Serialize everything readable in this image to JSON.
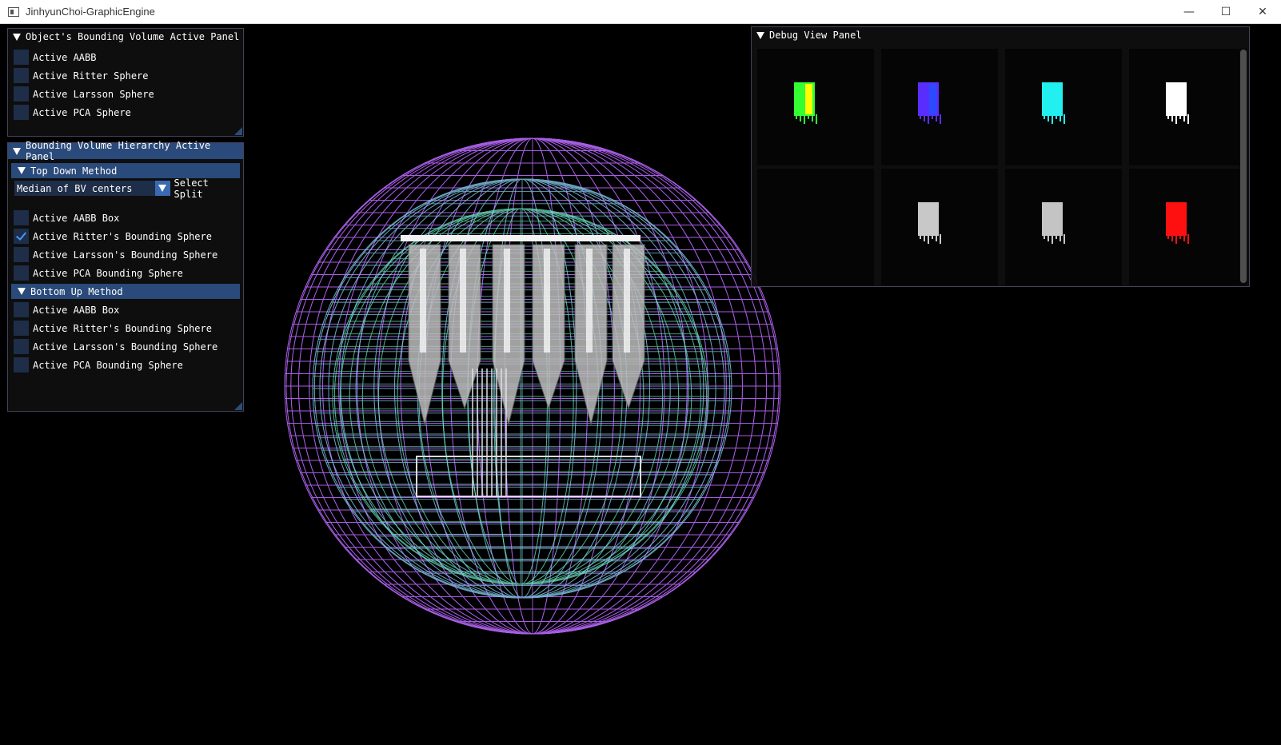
{
  "window": {
    "title": "JinhyunChoi-GraphicEngine",
    "minimize": "—",
    "maximize": "☐",
    "close": "✕"
  },
  "object_panel": {
    "title": "Object's Bounding Volume Active Panel",
    "items": [
      {
        "label": "Active AABB",
        "checked": false
      },
      {
        "label": "Active Ritter Sphere",
        "checked": false
      },
      {
        "label": "Active Larsson Sphere",
        "checked": false
      },
      {
        "label": "Active PCA Sphere",
        "checked": false
      }
    ]
  },
  "bvh_panel": {
    "title": "Bounding Volume Hierarchy Active Panel",
    "top_down": {
      "title": "Top Down Method",
      "split_value": "Median of BV centers",
      "split_label": "Select Split",
      "items": [
        {
          "label": "Active AABB Box",
          "checked": false
        },
        {
          "label": "Active Ritter's Bounding Sphere",
          "checked": true
        },
        {
          "label": "Active Larsson's Bounding Sphere",
          "checked": false
        },
        {
          "label": "Active PCA Bounding Sphere",
          "checked": false
        }
      ]
    },
    "bottom_up": {
      "title": "Bottom Up Method",
      "items": [
        {
          "label": "Active AABB Box",
          "checked": false
        },
        {
          "label": "Active Ritter's Bounding Sphere",
          "checked": false
        },
        {
          "label": "Active Larsson's Bounding Sphere",
          "checked": false
        },
        {
          "label": "Active PCA Bounding Sphere",
          "checked": false
        }
      ]
    }
  },
  "debug_panel": {
    "title": "Debug View Panel",
    "tiles": [
      {
        "color": "#33ff33",
        "accent": "#ffff00"
      },
      {
        "color": "#5a2dff",
        "accent": "#2a4bff"
      },
      {
        "color": "#22f0f0",
        "accent": "#22f0f0"
      },
      {
        "color": "#ffffff",
        "accent": "#ffffff"
      },
      {
        "color": "",
        "accent": ""
      },
      {
        "color": "#c8c8c8",
        "accent": "#c8c8c8"
      },
      {
        "color": "#c4c4c4",
        "accent": "#c4c4c4"
      },
      {
        "color": "#ff1010",
        "accent": "#ff1010"
      }
    ]
  },
  "colors": {
    "outer_sphere": "#b062f0",
    "inner_sphere": "#80c8e8",
    "cyan_sphere": "#6ff0c8",
    "header_blue": "#294a7a",
    "check_blue": "#4296fa"
  }
}
